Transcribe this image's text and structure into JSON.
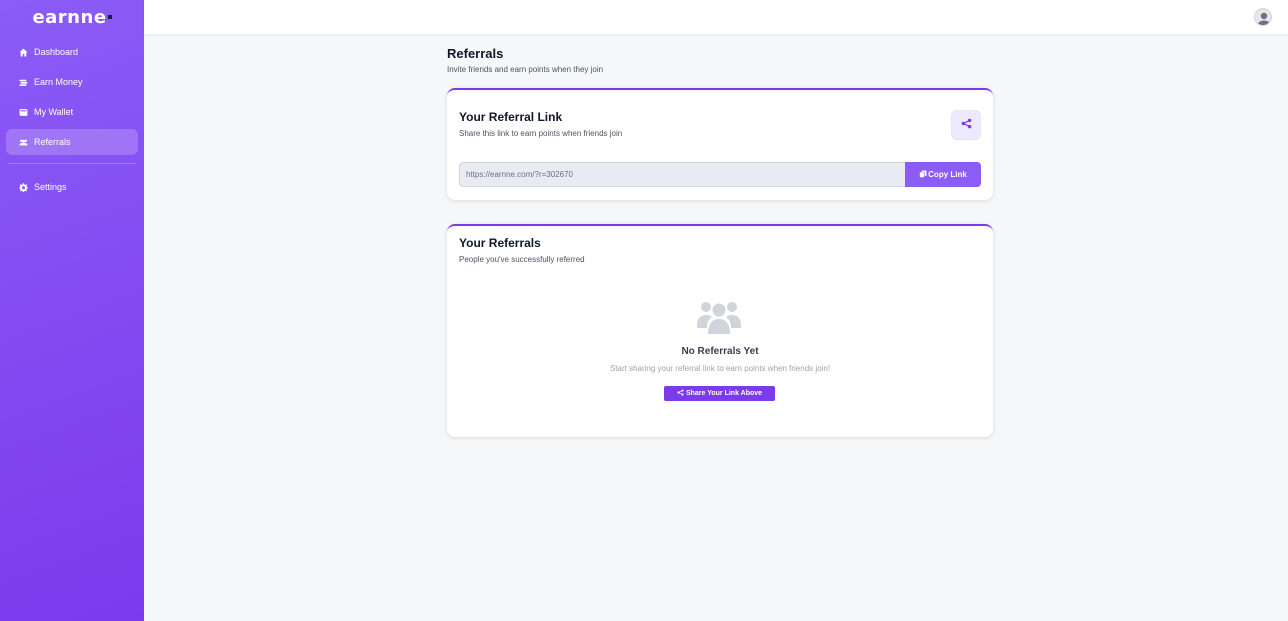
{
  "app": {
    "logo": "earnne"
  },
  "sidebar": {
    "items": [
      {
        "label": "Dashboard",
        "icon": "home-icon"
      },
      {
        "label": "Earn Money",
        "icon": "money-icon"
      },
      {
        "label": "My Wallet",
        "icon": "wallet-icon"
      },
      {
        "label": "Referrals",
        "icon": "users-icon",
        "active": true
      }
    ],
    "settings": {
      "label": "Settings",
      "icon": "gear-icon"
    }
  },
  "topbar": {
    "avatar": "user-avatar-icon"
  },
  "page": {
    "title": "Referrals",
    "subtitle": "Invite friends and earn points when they join"
  },
  "referral_link_card": {
    "title": "Your Referral Link",
    "subtitle": "Share this link to earn points when friends join",
    "link_value": "https://earnne.com/?r=302670",
    "copy_label": "Copy Link",
    "share_icon": "share-icon"
  },
  "referrals_card": {
    "title": "Your Referrals",
    "subtitle": "People you've successfully referred",
    "empty_title": "No Referrals Yet",
    "empty_subtitle": "Start sharing your referral link to earn points when friends join!",
    "cta_label": "Share Your Link Above"
  },
  "colors": {
    "accent": "#7c3aed",
    "sidebar_start": "#8b5cf6",
    "sidebar_end": "#7c3aed",
    "page_bg": "#f6f7f9"
  }
}
